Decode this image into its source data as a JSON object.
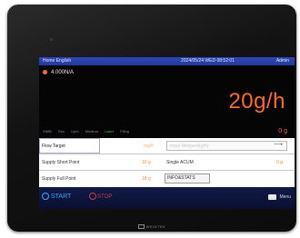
{
  "topbar": {
    "home": "Home English",
    "datetime": "2024/05/24 WED 08:52:01",
    "user": "Admin"
  },
  "status": {
    "text": "4.000N/A"
  },
  "rate": {
    "value": "20g/h"
  },
  "modes": [
    "SIMB",
    "Sen",
    "Upm",
    "Medium",
    "Laser",
    "Filing"
  ],
  "side_value": "0 g",
  "table": {
    "flow_target_label": "Flow Target",
    "flow_target_unit": "mg/h",
    "flow_target_placeholder": "Input Weigand(g/h)",
    "supply_short_point_label": "Supply Short Point",
    "supply_short_point_value": "10 g",
    "single_acum_label": "Single ACUM",
    "single_acum_value": "0 g",
    "supply_full_point_label": "Supply Full Point",
    "supply_full_point_value": "18 g",
    "info_button": "INFO&STATS"
  },
  "bottombar": {
    "start_label": "START",
    "stop_label": "STOP",
    "menu_label": "Menu"
  },
  "brand": "WEINTEK",
  "colors": {
    "accent": "#ff6b26",
    "topbar": "#2e47b8",
    "start": "#3ba8ff",
    "stop": "#d03b3b",
    "active_mode": "#38c64a"
  }
}
